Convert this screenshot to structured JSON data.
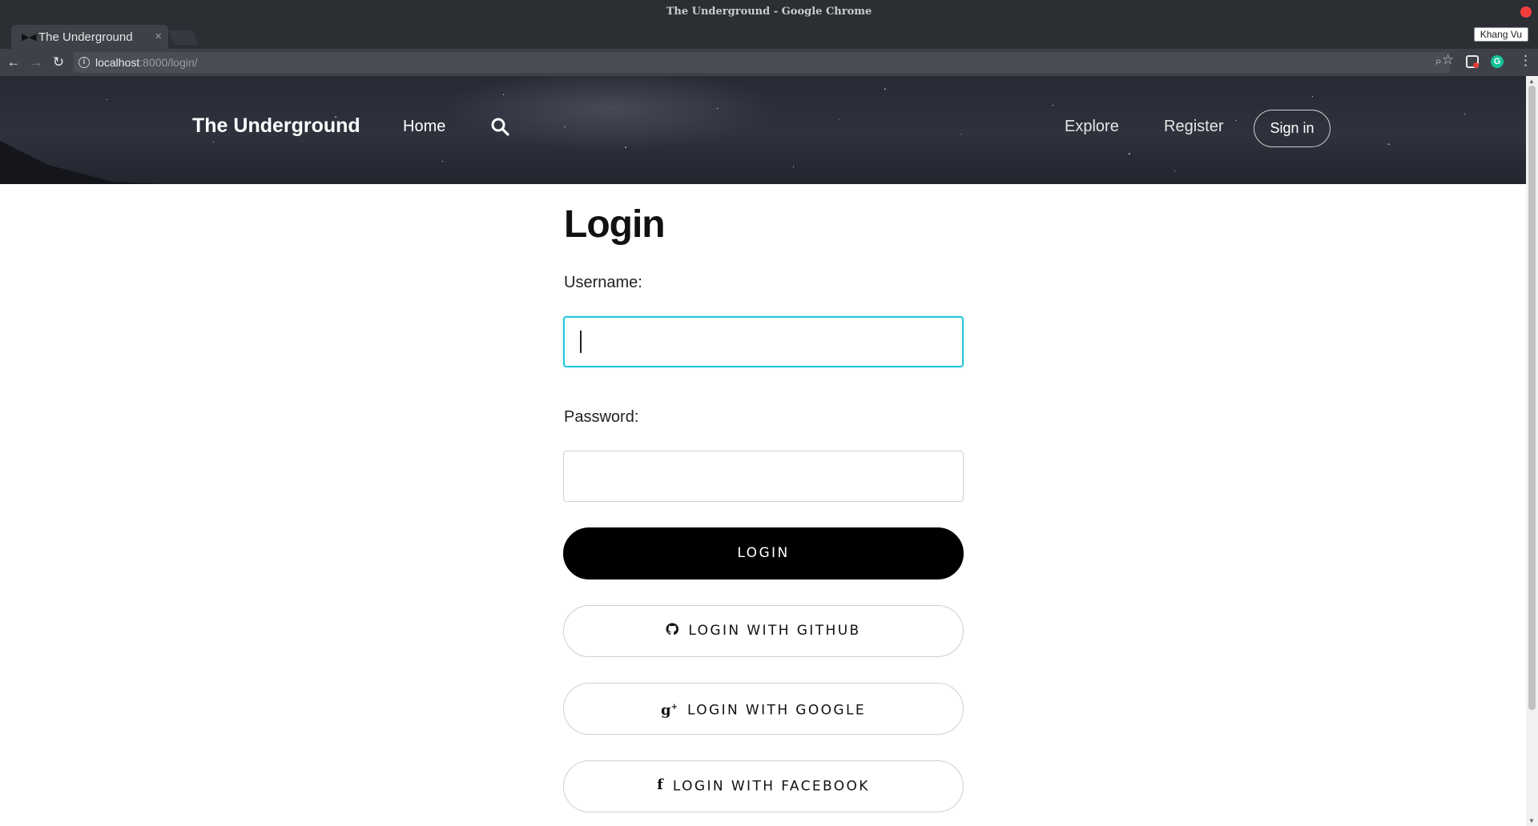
{
  "window": {
    "title": "The Underground - Google Chrome"
  },
  "browser": {
    "tab_title": "The Underground",
    "tab_close": "×",
    "profile_name": "Khang Vu",
    "url_host": "localhost",
    "url_rest": ":8000/login/",
    "info_glyph": "i",
    "ext_g_glyph": "G"
  },
  "nav": {
    "brand": "The Underground",
    "home": "Home",
    "explore": "Explore",
    "register": "Register",
    "signin": "Sign in"
  },
  "form": {
    "title": "Login",
    "username_label": "Username:",
    "username_value": "",
    "password_label": "Password:",
    "password_value": "",
    "login_button": "LOGIN",
    "github_button": "LOGIN WITH GITHUB",
    "google_button": "LOGIN WITH GOOGLE",
    "facebook_button": "LOGIN WITH FACEBOOK",
    "google_glyph": "g",
    "google_plus": "+",
    "facebook_glyph": "f"
  },
  "colors": {
    "focus_border": "#22c6e0",
    "primary_button": "#000000",
    "close_dot": "#f23d3d"
  },
  "icons": [
    "search-icon",
    "github-icon",
    "google-plus-icon",
    "facebook-icon",
    "back-arrow-icon",
    "forward-arrow-icon",
    "reload-icon",
    "info-icon",
    "zoom-icon",
    "star-icon",
    "menu-icon"
  ]
}
